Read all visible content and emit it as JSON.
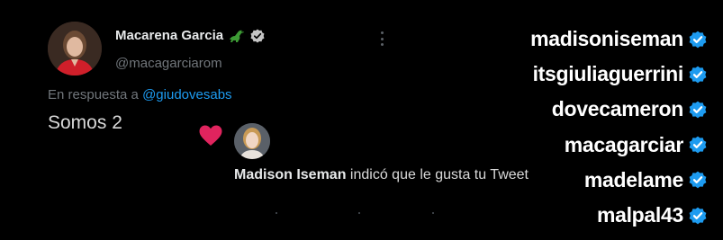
{
  "tweet": {
    "display_name": "Macarena Garcia",
    "emoji_icon": "dinosaur-emoji-icon",
    "verified_icon": "verified-badge-icon",
    "handle": "@macagarciarom",
    "reply_prefix": "En respuesta a",
    "reply_to": "@giudovesabs",
    "text": "Somos 2"
  },
  "notification": {
    "icon": "heart-icon",
    "liker_name": "Madison Iseman",
    "action_text": " indicó que le gusta tu Tweet"
  },
  "usernames": [
    "madisoniseman",
    "itsgiuliaguerrini",
    "dovecameron",
    "macagarciar",
    "madelame",
    "malpal43"
  ],
  "colors": {
    "background": "#000000",
    "link": "#1d9bf0",
    "heart": "#e0245e",
    "verified_blue": "#1d9bf0",
    "verified_gray": "#c4c4c4",
    "emoji_green": "#3d9b35"
  }
}
